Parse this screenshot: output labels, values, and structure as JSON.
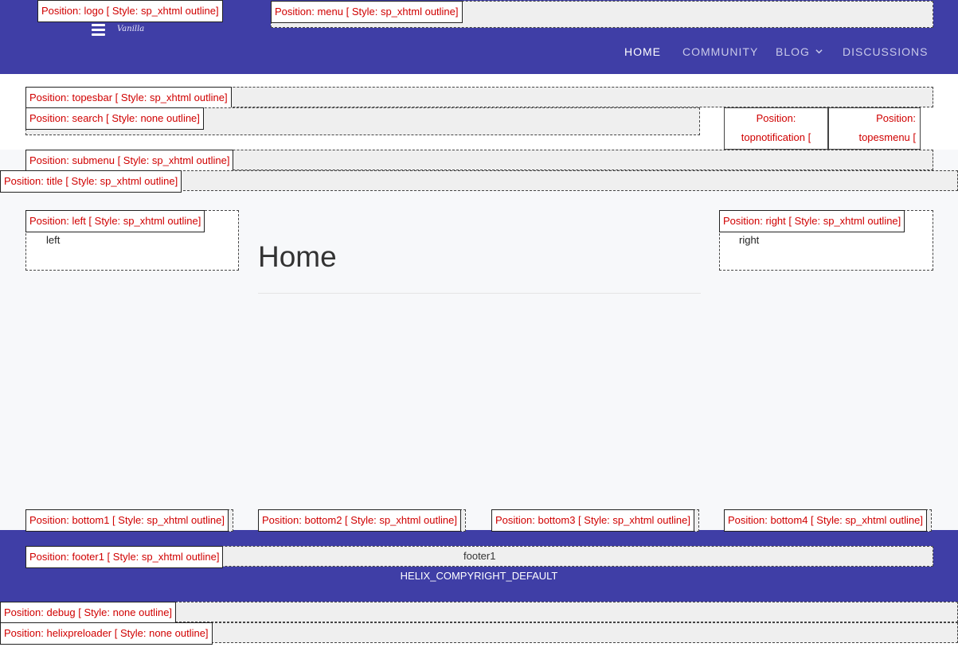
{
  "header": {
    "logo_text": "Vanilla",
    "nav": [
      {
        "label": "HOME",
        "active": true
      },
      {
        "label": "COMMUNITY",
        "active": false
      },
      {
        "label": "BLOG",
        "active": false,
        "has_dropdown": true
      },
      {
        "label": "DISCUSSIONS",
        "active": false
      }
    ]
  },
  "positions": {
    "logo": "Position: logo [ Style: sp_xhtml outline]",
    "menu": "Position: menu [ Style: sp_xhtml outline]",
    "topesbar": "Position: topesbar [ Style: sp_xhtml outline]",
    "search": "Position: search [ Style: none outline]",
    "topnotification": "Position: topnotification [",
    "topesmenu": "Position: topesmenu [",
    "submenu": "Position: submenu [ Style: sp_xhtml outline]",
    "title": "Position: title [ Style: sp_xhtml outline]",
    "left": "Position: left [ Style: sp_xhtml outline]",
    "right": "Position: right [ Style: sp_xhtml outline]",
    "bottom1": "Position: bottom1 [ Style: sp_xhtml outline]",
    "bottom2": "Position: bottom2 [ Style: sp_xhtml outline]",
    "bottom3": "Position: bottom3 [ Style: sp_xhtml outline]",
    "bottom4": "Position: bottom4 [ Style: sp_xhtml outline]",
    "footer1": "Position: footer1 [ Style: sp_xhtml outline]",
    "debug": "Position: debug [ Style: none outline]",
    "helixpreloader": "Position: helixpreloader [ Style: none outline]"
  },
  "modules": {
    "left_text": "left",
    "right_text": "right",
    "footer1_text": "footer1"
  },
  "main": {
    "page_title": "Home"
  },
  "footer": {
    "copyright": "HELIX_COMPYRIGHT_DEFAULT"
  },
  "colors": {
    "header_bg": "#3f3ea6",
    "label_text": "#d00000"
  },
  "icons": {
    "menu_toggle": "hamburger-icon",
    "blog_dropdown": "chevron-down-icon"
  }
}
